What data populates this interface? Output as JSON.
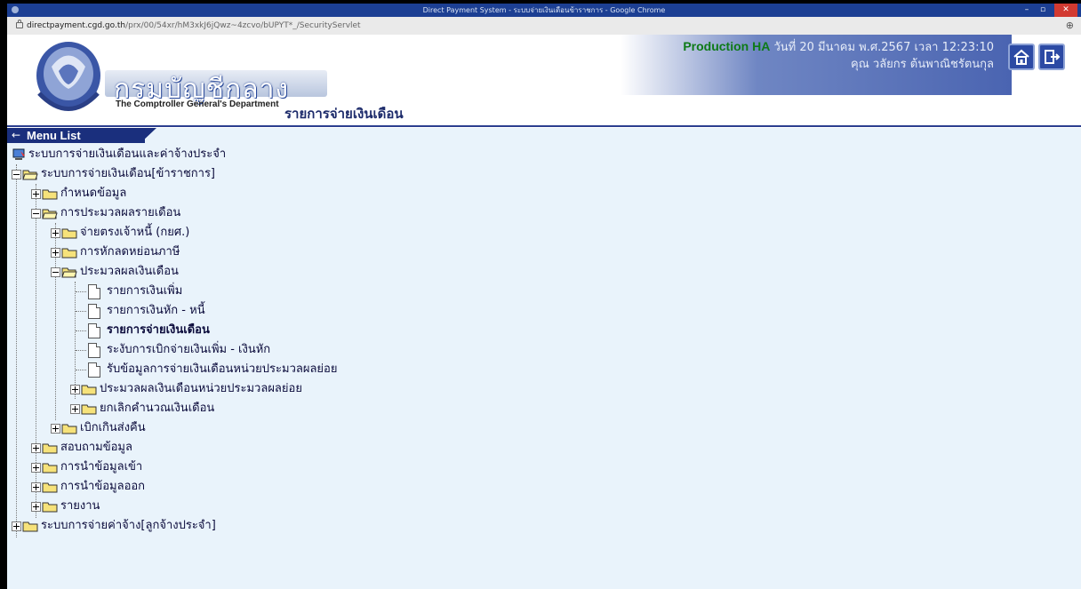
{
  "browser": {
    "window_title": "Direct Payment System - ระบบจ่ายเงินเดือนข้าราชการ - Google Chrome",
    "url_host": "directpayment.cgd.go.th",
    "url_path": "/prx/00/54xr/hM3xkJ6jQwz~4zcvo/bUPYT*_/SecurityServlet"
  },
  "header": {
    "org_name_th": "กรมบัญชีกลาง",
    "org_name_en": "The Comptroller General's Department",
    "page_title": "รายการจ่ายเงินเดือน",
    "environment": "Production HA",
    "datetime": "วันที่ 20 มีนาคม พ.ศ.2567 เวลา 12:23:10",
    "user": "คุณ วลัยกร ต้นพาณิชรัตนกุล"
  },
  "menu": {
    "title": "Menu List",
    "root": "ระบบการจ่ายเงินเดือนและค่าจ้างประจำ",
    "items": [
      "ระบบการจ่ายเงินเดือน[ข้าราชการ]",
      "กำหนดข้อมูล",
      "การประมวลผลรายเดือน",
      "จ่ายตรงเจ้าหนี้ (กยศ.)",
      "การหักลดหย่อนภาษี",
      "ประมวลผลเงินเดือน",
      "รายการเงินเพิ่ม",
      "รายการเงินหัก - หนี้",
      "รายการจ่ายเงินเดือน",
      "ระงับการเบิกจ่ายเงินเพิ่ม - เงินหัก",
      "รับข้อมูลการจ่ายเงินเดือนหน่วยประมวลผลย่อย",
      "ประมวลผลเงินเดือนหน่วยประมวลผลย่อย",
      "ยกเลิกคำนวณเงินเดือน",
      "เบิกเกินส่งคืน",
      "สอบถามข้อมูล",
      "การนำข้อมูลเข้า",
      "การนำข้อมูลออก",
      "รายงาน",
      "ระบบการจ่ายค่าจ้าง[ลูกจ้างประจำ]"
    ]
  },
  "colors": {
    "page_bg": "#e9f3fb",
    "menu_bar": "#1a2f7d",
    "environment": "#0e7a17"
  }
}
